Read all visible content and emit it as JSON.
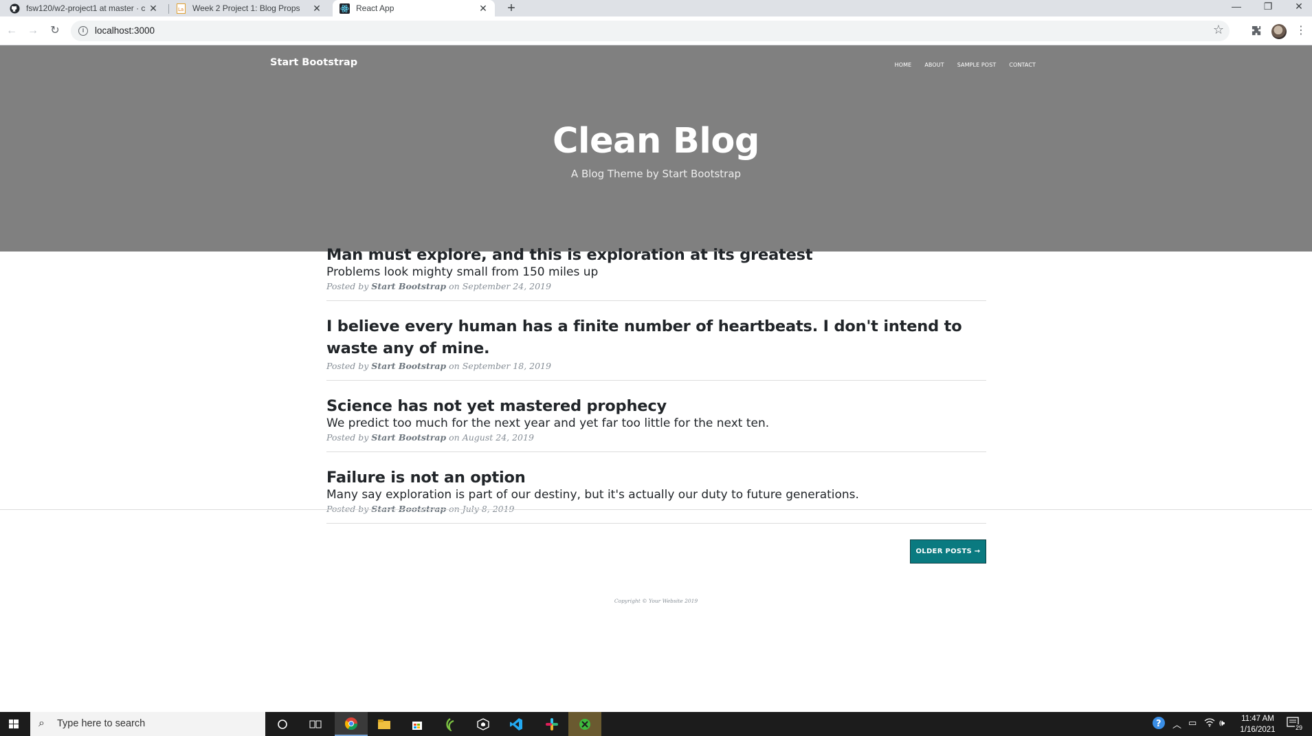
{
  "browser": {
    "tabs": [
      {
        "title": "fsw120/w2-project1 at master · c",
        "icon": "github-icon"
      },
      {
        "title": "Week 2 Project 1: Blog Props",
        "icon": "document-icon"
      },
      {
        "title": "React App",
        "icon": "react-icon",
        "active": true
      }
    ],
    "new_tab_label": "+",
    "url": "localhost:3000"
  },
  "site": {
    "brand": "Start Bootstrap",
    "nav": [
      "HOME",
      "ABOUT",
      "SAMPLE POST",
      "CONTACT"
    ],
    "hero_title": "Clean Blog",
    "hero_subtitle": "A Blog Theme by Start Bootstrap"
  },
  "posts": [
    {
      "title": "Man must explore, and this is exploration at its greatest",
      "subtitle": "Problems look mighty small from 150 miles up",
      "posted_by_prefix": "Posted by",
      "author": "Start Bootstrap",
      "date": "on September 24, 2019"
    },
    {
      "title": "I believe every human has a finite number of heartbeats. I don't intend to waste any of mine.",
      "subtitle": "",
      "posted_by_prefix": "Posted by",
      "author": "Start Bootstrap",
      "date": "on September 18, 2019"
    },
    {
      "title": "Science has not yet mastered prophecy",
      "subtitle": "We predict too much for the next year and yet far too little for the next ten.",
      "posted_by_prefix": "Posted by",
      "author": "Start Bootstrap",
      "date": "on August 24, 2019"
    },
    {
      "title": "Failure is not an option",
      "subtitle": "Many say exploration is part of our destiny, but it's actually our duty to future generations.",
      "posted_by_prefix": "Posted by",
      "author": "Start Bootstrap",
      "date": "on July 8, 2019"
    }
  ],
  "older_posts_label": "OLDER POSTS →",
  "copyright": "Copyright © Your Website 2019",
  "taskbar": {
    "search_placeholder": "Type here to search",
    "time": "11:47 AM",
    "date": "1/16/2021",
    "notification_count": "29"
  },
  "colors": {
    "masthead": "#808080",
    "button": "#0a7a80",
    "taskbar": "#1c1c1c"
  }
}
